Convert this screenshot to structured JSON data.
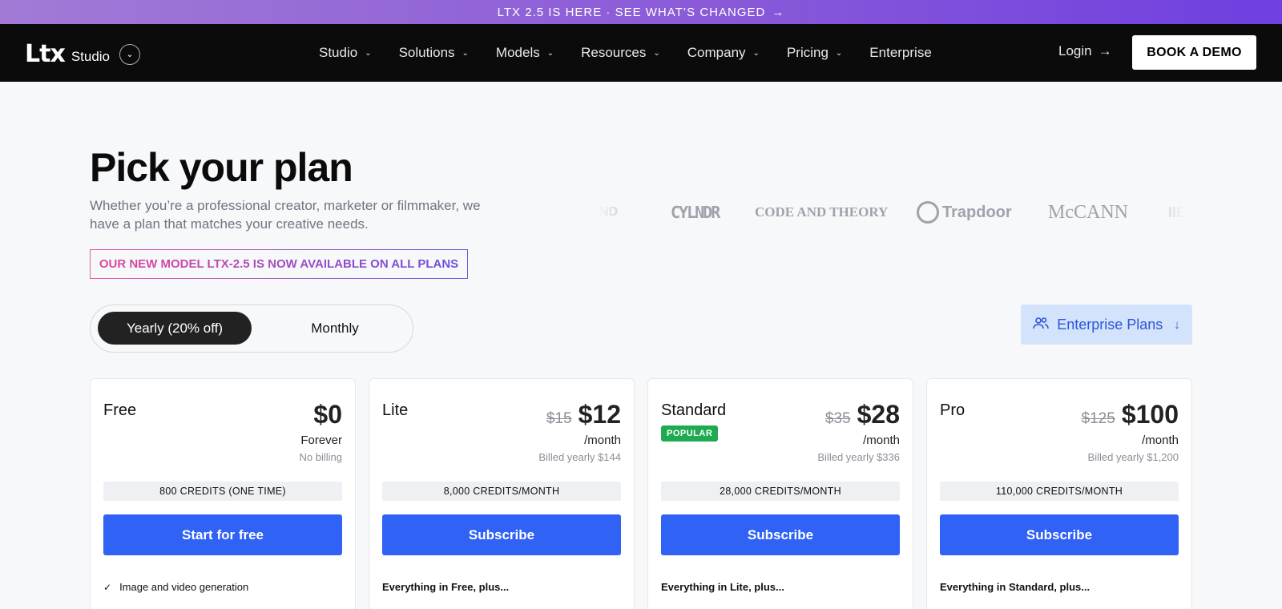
{
  "announcement": {
    "text": "LTX 2.5 IS HERE · SEE WHAT’S CHANGED",
    "arrow": "→"
  },
  "nav": {
    "logo_mark": "Ltx",
    "logo_sub": "Studio",
    "logo_toggle": "⌄",
    "items": [
      {
        "label": "Studio",
        "chevron": "⌄"
      },
      {
        "label": "Solutions",
        "chevron": "⌄"
      },
      {
        "label": "Models",
        "chevron": "⌄"
      },
      {
        "label": "Resources",
        "chevron": "⌄"
      },
      {
        "label": "Company",
        "chevron": "⌄"
      },
      {
        "label": "Pricing",
        "chevron": "⌄"
      },
      {
        "label": "Enterprise"
      }
    ],
    "login": "Login",
    "login_arrow": "→",
    "demo": "BOOK A DEMO"
  },
  "hero": {
    "title": "Pick your plan",
    "subtitle": "Whether you’re a professional creator, marketer or filmmaker, we have a plan that matches your creative needs.",
    "model_banner": "OUR NEW MODEL LTX-2.5 IS NOW AVAILABLE ON ALL PLANS"
  },
  "client_logos": {
    "b1": "RAND",
    "b2": "CYLNDR",
    "b3": "CODE AND THEORY",
    "b4": "Trapdoor",
    "b5": "McCANN",
    "b6": "IIE"
  },
  "billing_toggle": {
    "yearly": "Yearly (20% off)",
    "monthly": "Monthly",
    "selected": "yearly"
  },
  "enterprise": {
    "label": "Enterprise Plans",
    "icon": "users-icon",
    "arrow": "↓"
  },
  "plans": [
    {
      "name": "Free",
      "old_price": "",
      "price": "$0",
      "period": "Forever",
      "billing": "No billing",
      "credits": "800 CREDITS (ONE TIME)",
      "cta": "Start for free",
      "feature": "Image and video generation",
      "feature_check": "✓"
    },
    {
      "name": "Lite",
      "old_price": "$15",
      "price": "$12",
      "period": "/month",
      "billing": "Billed yearly $144",
      "credits": "8,000 CREDITS/MONTH",
      "cta": "Subscribe",
      "feature": "Everything in Free, plus..."
    },
    {
      "name": "Standard",
      "badge": "POPULAR",
      "old_price": "$35",
      "price": "$28",
      "period": "/month",
      "billing": "Billed yearly $336",
      "credits": "28,000 CREDITS/MONTH",
      "cta": "Subscribe",
      "feature": "Everything in Lite, plus..."
    },
    {
      "name": "Pro",
      "old_price": "$125",
      "price": "$100",
      "period": "/month",
      "billing": "Billed yearly $1,200",
      "credits": "110,000 CREDITS/MONTH",
      "cta": "Subscribe",
      "feature": "Everything in Standard, plus..."
    }
  ],
  "colors": {
    "accent": "#2f62f5",
    "popular": "#1faa52",
    "nav_bg": "#0b0b0c",
    "enterprise_bg": "#d3e3fb"
  }
}
